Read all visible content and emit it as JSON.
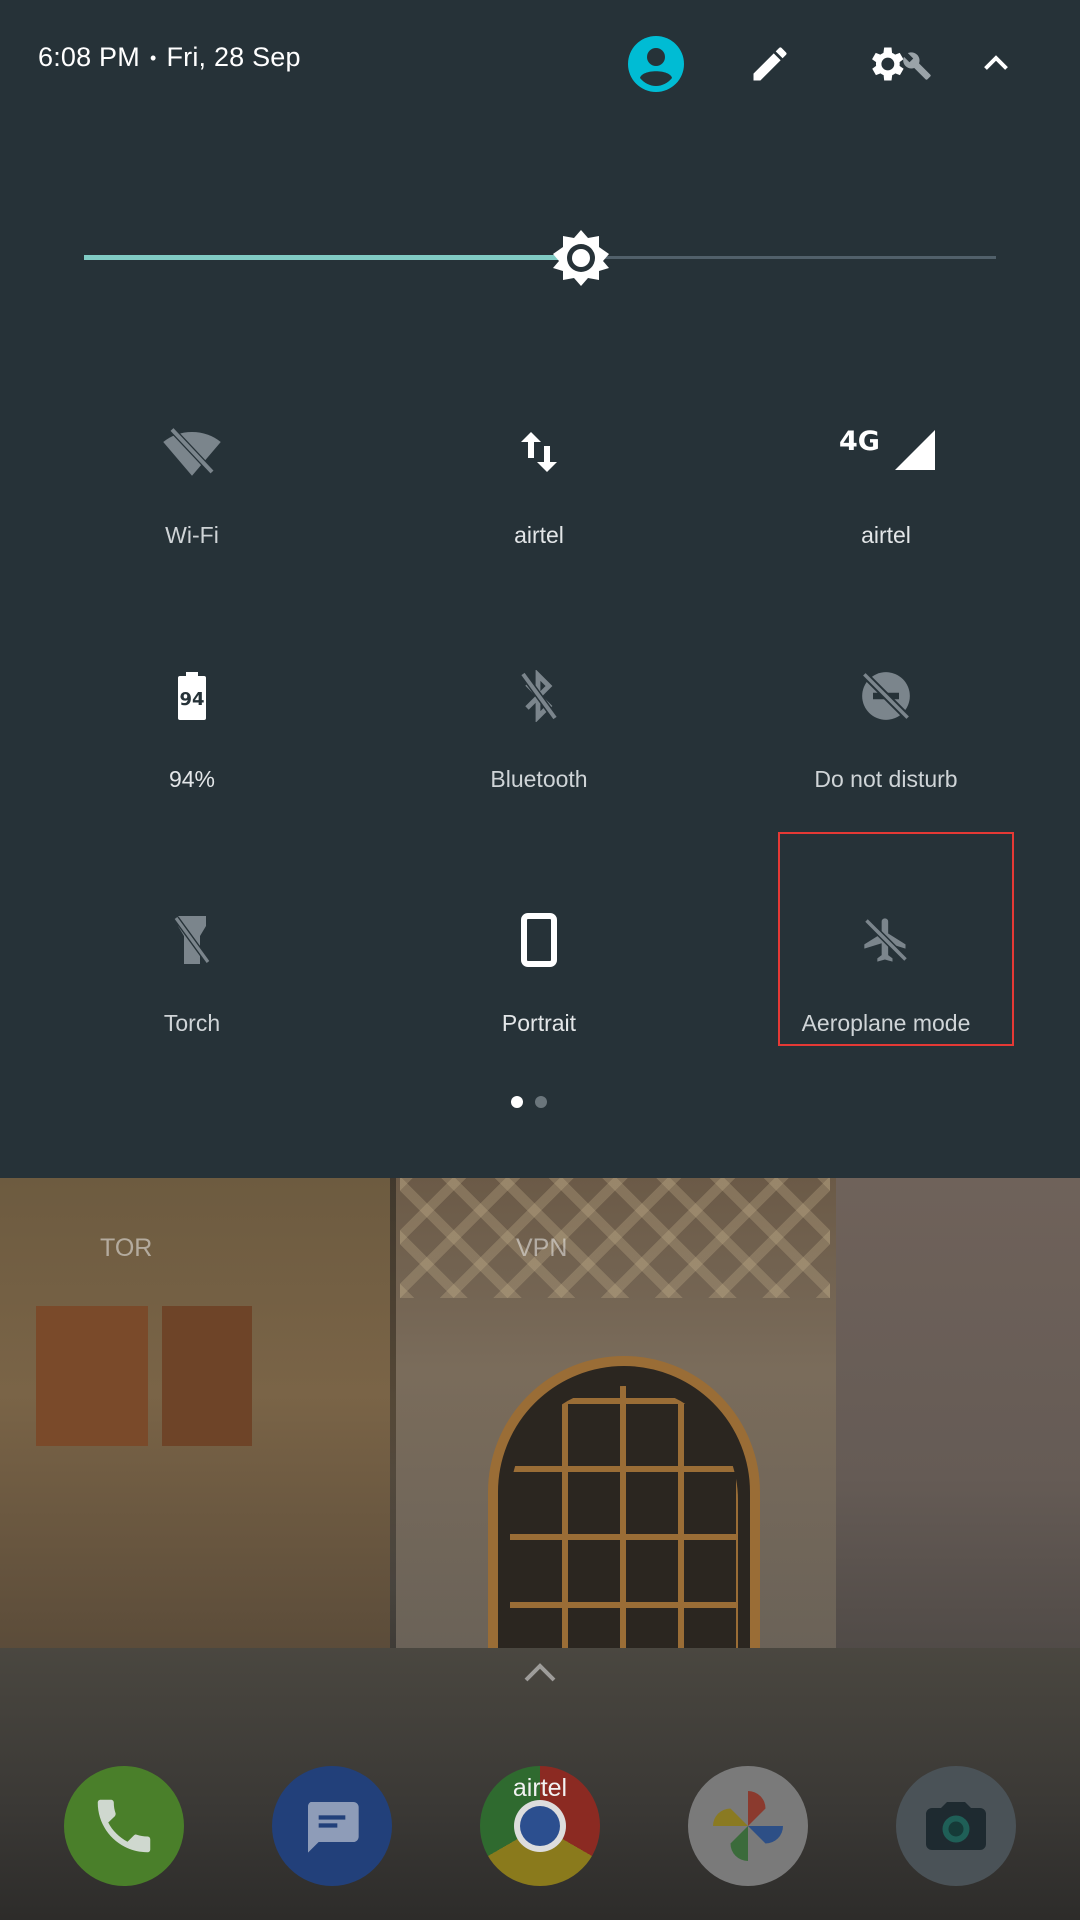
{
  "status": {
    "time": "6:08 PM",
    "separator": "•",
    "date": "Fri, 28 Sep"
  },
  "header_icons": [
    "user-account-icon",
    "edit-pencil-icon",
    "settings-gear-icon",
    "wrench-icon",
    "chevron-up-icon"
  ],
  "brightness": {
    "level_fraction": 0.545
  },
  "tiles": [
    {
      "label": "Wi-Fi",
      "icon": "wifi-off-icon",
      "active": false
    },
    {
      "label": "airtel",
      "icon": "mobile-data-arrows-icon",
      "active": true
    },
    {
      "label": "airtel",
      "icon": "4g-signal-icon",
      "network": "4G",
      "active": true
    },
    {
      "label": "94%",
      "icon": "battery-icon",
      "battery_value": "94",
      "active": true
    },
    {
      "label": "Bluetooth",
      "icon": "bluetooth-off-icon",
      "active": false
    },
    {
      "label": "Do not disturb",
      "icon": "do-not-disturb-off-icon",
      "active": false
    },
    {
      "label": "Torch",
      "icon": "torch-off-icon",
      "active": false
    },
    {
      "label": "Portrait",
      "icon": "portrait-phone-icon",
      "active": true
    },
    {
      "label": "Aeroplane mode",
      "icon": "aeroplane-off-icon",
      "active": false
    }
  ],
  "pager": {
    "pages": 2,
    "current": 1
  },
  "home": {
    "labels": {
      "tor": "TOR",
      "vpn": "VPN"
    },
    "dock": [
      {
        "name": "phone",
        "icon": "phone-icon"
      },
      {
        "name": "messages",
        "icon": "messages-icon"
      },
      {
        "name": "chrome",
        "icon": "chrome-icon",
        "label": "airtel"
      },
      {
        "name": "photos",
        "icon": "photos-icon"
      },
      {
        "name": "camera",
        "icon": "camera-icon"
      }
    ]
  },
  "colors": {
    "shade_bg": "#263238",
    "accent": "#80cbc4",
    "avatar": "#00bcd4",
    "highlight": "#e53935",
    "inactive_icon": "#7b858c"
  }
}
